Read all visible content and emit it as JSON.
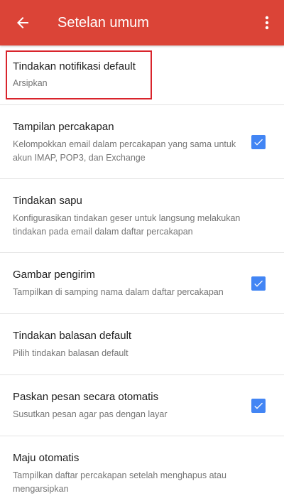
{
  "appbar": {
    "title": "Setelan umum",
    "color": "#db4437",
    "back_icon": "arrow-back-icon",
    "menu_icon": "more-vert-icon"
  },
  "settings": [
    {
      "title": "Tindakan notifikasi default",
      "summary": "Arsipkan",
      "has_checkbox": false
    },
    {
      "title": "Tampilan percakapan",
      "summary": "Kelompokkan email dalam percakapan yang sama untuk akun IMAP, POP3, dan Exchange",
      "has_checkbox": true,
      "checked": true
    },
    {
      "title": "Tindakan sapu",
      "summary": "Konfigurasikan tindakan geser untuk langsung melakukan tindakan pada email dalam daftar percakapan",
      "has_checkbox": false
    },
    {
      "title": "Gambar pengirim",
      "summary": "Tampilkan di samping nama dalam daftar percakapan",
      "has_checkbox": true,
      "checked": true
    },
    {
      "title": "Tindakan balasan default",
      "summary": "Pilih tindakan balasan default",
      "has_checkbox": false
    },
    {
      "title": "Paskan pesan secara otomatis",
      "summary": "Susutkan pesan agar pas dengan layar",
      "has_checkbox": true,
      "checked": true
    },
    {
      "title": "Maju otomatis",
      "summary": "Tampilkan daftar percakapan setelah menghapus atau mengarsipkan",
      "has_checkbox": false
    }
  ],
  "colors": {
    "checkbox": "#4285f4",
    "highlight": "#d9242c"
  }
}
